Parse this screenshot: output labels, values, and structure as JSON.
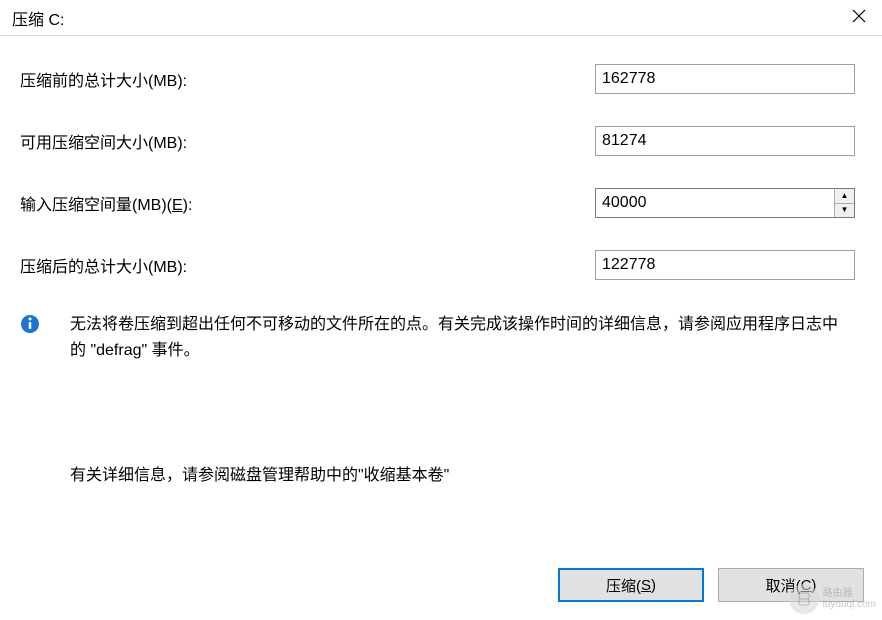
{
  "window": {
    "title": "压缩 C:"
  },
  "fields": {
    "total_before": {
      "label": "压缩前的总计大小(MB):",
      "value": "162778"
    },
    "available": {
      "label": "可用压缩空间大小(MB):",
      "value": "81274"
    },
    "amount": {
      "label_pre": "输入压缩空间量(MB)(",
      "label_accel": "E",
      "label_post": "):",
      "value": "40000"
    },
    "total_after": {
      "label": "压缩后的总计大小(MB):",
      "value": "122778"
    }
  },
  "info": {
    "text": "无法将卷压缩到超出任何不可移动的文件所在的点。有关完成该操作时间的详细信息，请参阅应用程序日志中的 \"defrag\" 事件。"
  },
  "help": {
    "text": "有关详细信息，请参阅磁盘管理帮助中的\"收缩基本卷\""
  },
  "buttons": {
    "shrink_pre": "压缩(",
    "shrink_accel": "S",
    "shrink_post": ")",
    "cancel_pre": "取消(",
    "cancel_accel": "C",
    "cancel_post": ")"
  },
  "watermark": {
    "brand": "路由器",
    "site": "luyouqi.com"
  }
}
